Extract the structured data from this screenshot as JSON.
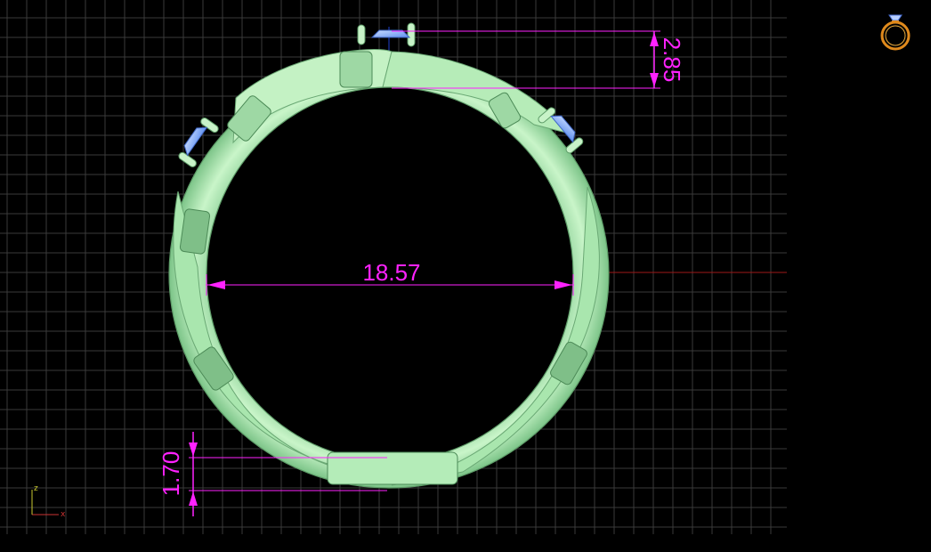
{
  "viewport": {
    "name": "front-view-cad-viewport",
    "background": "#000000",
    "grid_color": "#3a3a3a",
    "model_color": "#b8efb8",
    "gem_color": "#7aa8ff",
    "dimension_color": "#ff22ff"
  },
  "dimensions": {
    "inner_diameter": "18.57",
    "top_height": "2.85",
    "band_thickness": "1.70"
  },
  "axis_gizmo": {
    "z_label": "z",
    "x_label": "x"
  },
  "view_cube": {
    "icon": "ring-icon"
  }
}
